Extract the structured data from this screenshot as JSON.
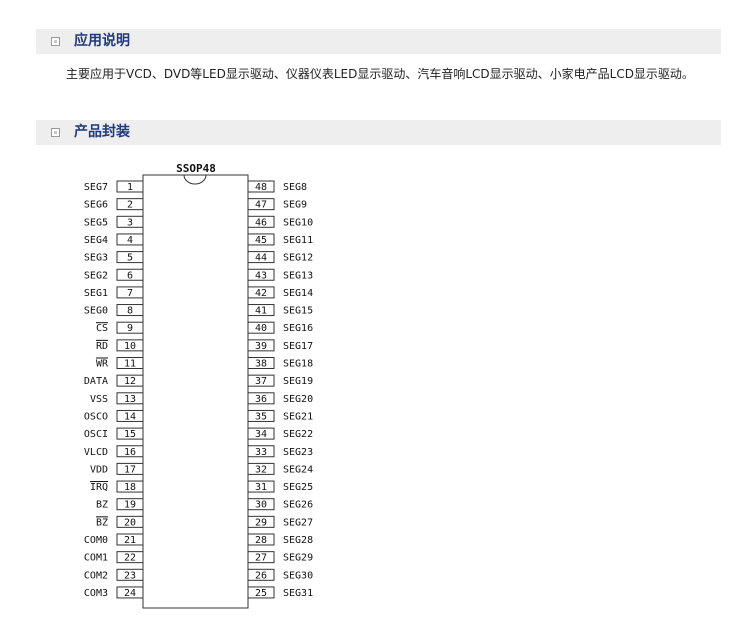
{
  "sections": [
    {
      "title": "应用说明"
    },
    {
      "title": "产品封装"
    }
  ],
  "application_text": "主要应用于VCD、DVD等LED显示驱动、仪器仪表LED显示驱动、汽车音响LCD显示驱动、小家电产品LCD显示驱动。",
  "package": {
    "name": "SSOP48",
    "left_pins": [
      {
        "num": "1",
        "label": "SEG7"
      },
      {
        "num": "2",
        "label": "SEG6"
      },
      {
        "num": "3",
        "label": "SEG5"
      },
      {
        "num": "4",
        "label": "SEG4"
      },
      {
        "num": "5",
        "label": "SEG3"
      },
      {
        "num": "6",
        "label": "SEG2"
      },
      {
        "num": "7",
        "label": "SEG1"
      },
      {
        "num": "8",
        "label": "SEG0"
      },
      {
        "num": "9",
        "label": "CS",
        "overline": true
      },
      {
        "num": "10",
        "label": "RD",
        "overline": true
      },
      {
        "num": "11",
        "label": "WR",
        "overline": true
      },
      {
        "num": "12",
        "label": "DATA"
      },
      {
        "num": "13",
        "label": "VSS"
      },
      {
        "num": "14",
        "label": "OSCO"
      },
      {
        "num": "15",
        "label": "OSCI"
      },
      {
        "num": "16",
        "label": "VLCD"
      },
      {
        "num": "17",
        "label": "VDD"
      },
      {
        "num": "18",
        "label": "IRQ",
        "overline": true
      },
      {
        "num": "19",
        "label": "BZ"
      },
      {
        "num": "20",
        "label": "BZ",
        "overline": true
      },
      {
        "num": "21",
        "label": "COM0"
      },
      {
        "num": "22",
        "label": "COM1"
      },
      {
        "num": "23",
        "label": "COM2"
      },
      {
        "num": "24",
        "label": "COM3"
      }
    ],
    "right_pins": [
      {
        "num": "48",
        "label": "SEG8"
      },
      {
        "num": "47",
        "label": "SEG9"
      },
      {
        "num": "46",
        "label": "SEG10"
      },
      {
        "num": "45",
        "label": "SEG11"
      },
      {
        "num": "44",
        "label": "SEG12"
      },
      {
        "num": "43",
        "label": "SEG13"
      },
      {
        "num": "42",
        "label": "SEG14"
      },
      {
        "num": "41",
        "label": "SEG15"
      },
      {
        "num": "40",
        "label": "SEG16"
      },
      {
        "num": "39",
        "label": "SEG17"
      },
      {
        "num": "38",
        "label": "SEG18"
      },
      {
        "num": "37",
        "label": "SEG19"
      },
      {
        "num": "36",
        "label": "SEG20"
      },
      {
        "num": "35",
        "label": "SEG21"
      },
      {
        "num": "34",
        "label": "SEG22"
      },
      {
        "num": "33",
        "label": "SEG23"
      },
      {
        "num": "32",
        "label": "SEG24"
      },
      {
        "num": "31",
        "label": "SEG25"
      },
      {
        "num": "30",
        "label": "SEG26"
      },
      {
        "num": "29",
        "label": "SEG27"
      },
      {
        "num": "28",
        "label": "SEG28"
      },
      {
        "num": "27",
        "label": "SEG29"
      },
      {
        "num": "26",
        "label": "SEG30"
      },
      {
        "num": "25",
        "label": "SEG31"
      }
    ]
  }
}
